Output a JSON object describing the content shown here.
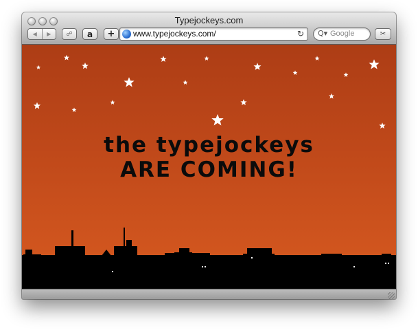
{
  "window": {
    "title": "Typejockeys.com"
  },
  "toolbar": {
    "back_icon": "back-arrow-icon",
    "forward_icon": "forward-arrow-icon",
    "bookmarks_glyph": "☍",
    "amazon_glyph": "a",
    "add_bookmark_glyph": "+",
    "url": "www.typejockeys.com/",
    "reload_glyph": "↻",
    "search_placeholder": "Google",
    "search_glyph": "Q▾",
    "snippet_glyph": "✂"
  },
  "content": {
    "headline_line1": "the typejockeys",
    "headline_line2": "ARE COMING!",
    "colors": {
      "sky_top": "#ad3d15",
      "sky_bottom": "#d75a20",
      "skyline": "#000000",
      "stars": "#ffffff",
      "text": "#0b0b0b"
    }
  }
}
